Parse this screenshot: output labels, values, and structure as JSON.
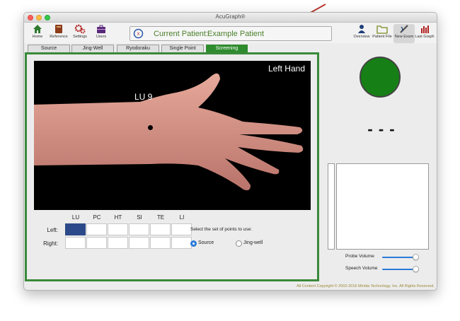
{
  "window": {
    "title": "AcuGraph®"
  },
  "toolbar": {
    "left": [
      {
        "label": "Home",
        "icon": "home-icon",
        "color": "#2f7a2f"
      },
      {
        "label": "Reference",
        "icon": "book-icon",
        "color": "#8b3a1a"
      },
      {
        "label": "Settings",
        "icon": "gears-icon",
        "color": "#b01e1e"
      },
      {
        "label": "Users",
        "icon": "briefcase-icon",
        "color": "#5a2a7a"
      }
    ],
    "right": [
      {
        "label": "Overview",
        "icon": "person-icon",
        "color": "#1f3f7a"
      },
      {
        "label": "Patient File",
        "icon": "folder-icon",
        "color": "#7a8a20"
      },
      {
        "label": "New Exam",
        "icon": "probe-icon",
        "color": "#4a4a4a"
      },
      {
        "label": "Last Graph",
        "icon": "bar-chart-icon",
        "color": "#b01e1e"
      }
    ]
  },
  "patient": {
    "label": "Current Patient:",
    "name": "Example Patient"
  },
  "tabs": [
    {
      "label": "Source"
    },
    {
      "label": "Jing-Well"
    },
    {
      "label": "Ryodoraku"
    },
    {
      "label": "Single Point"
    },
    {
      "label": "Screening"
    }
  ],
  "active_tab": "Screening",
  "photo": {
    "title": "Left Hand",
    "point_label": "LU 9"
  },
  "grid": {
    "columns": [
      "LU",
      "PC",
      "HT",
      "SI",
      "TE",
      "LI"
    ],
    "rows": [
      "Left:",
      "Right:"
    ],
    "highlighted": {
      "row": "Left:",
      "column": "LU"
    }
  },
  "point_set": {
    "label": "Select the set of points to use:",
    "options": [
      "Source",
      "Jing-well"
    ],
    "selected": "Source"
  },
  "status": {
    "color": "#168016",
    "readout": "- - -"
  },
  "sliders": [
    {
      "label": "Probe Volume",
      "level": 0.95
    },
    {
      "label": "Speech Volume",
      "level": 0.95
    }
  ],
  "footer": {
    "text": "All Content Copyright © 2002-2016 Miridia Technology, Inc. All Rights Reserved."
  },
  "colors": {
    "accent": "#3a8a3a",
    "selected_cell": "#2c4a8a",
    "arrow": "#b83a32"
  }
}
